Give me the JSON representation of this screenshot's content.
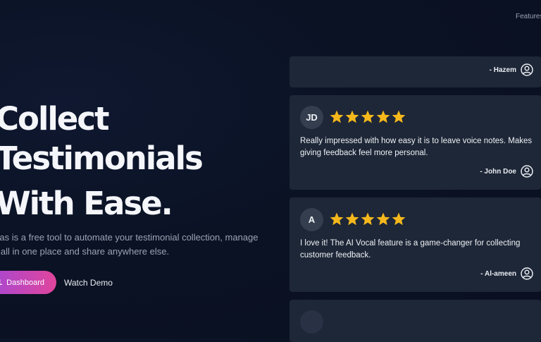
{
  "nav": {
    "features_label": "Features"
  },
  "hero": {
    "title_line_1": "Collect",
    "title_line_2": "Testimonials",
    "title_line_3": "With Ease.",
    "description": "zias is a free tool to automate your testimonial collection, manage\nn all in one place and share anywhere else.",
    "dashboard_button_label": "Dashboard",
    "dashboard_button_icon": "bar-chart-icon",
    "watch_demo_label": "Watch Demo"
  },
  "colors": {
    "background": "#0b1224",
    "card": "#1e2737",
    "star": "#f5b81c",
    "button_gradient_start": "#a348d6",
    "button_gradient_end": "#e0459c"
  },
  "testimonials": [
    {
      "author": "- Hazem",
      "author_icon": "user-circle-icon"
    },
    {
      "initials": "JD",
      "rating": 5,
      "text": "Really impressed with how easy it is to leave voice notes. Makes giving feedback feel more personal.",
      "author": "- John Doe",
      "author_icon": "user-circle-icon"
    },
    {
      "initials": "A",
      "rating": 5,
      "text": "I love it! The AI Vocal feature is a game-changer for collecting customer feedback.",
      "author": "- Al-ameen",
      "author_icon": "user-circle-icon"
    }
  ]
}
